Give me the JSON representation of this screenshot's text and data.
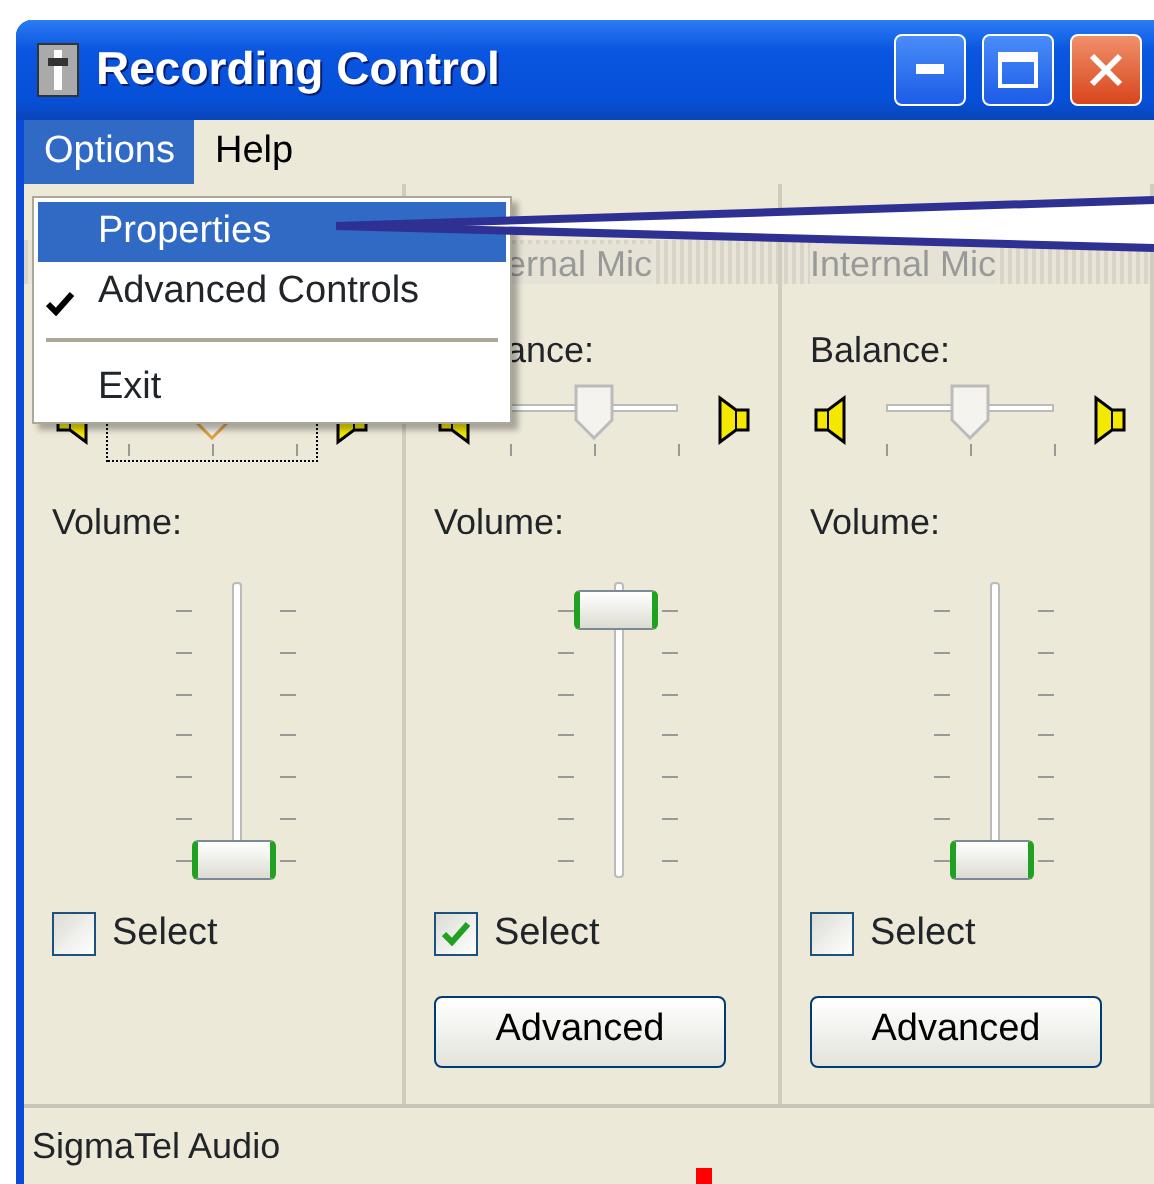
{
  "window": {
    "title": "Recording Control"
  },
  "menu_bar": [
    {
      "label": "Options",
      "selected": true
    },
    {
      "label": "Help",
      "selected": false
    }
  ],
  "dropdown": [
    {
      "kind": "item",
      "label": "Properties",
      "selected": true,
      "checked": false
    },
    {
      "kind": "item",
      "label": "Advanced Controls",
      "selected": false,
      "checked": true
    },
    {
      "kind": "separator"
    },
    {
      "kind": "item",
      "label": "Exit",
      "selected": false,
      "checked": false
    }
  ],
  "channels": [
    {
      "balance": {
        "level": 0.5,
        "focused": true
      },
      "volume_label": "Volume:",
      "volume": {
        "level": 0
      },
      "select": {
        "label": "Select",
        "checked": false
      }
    },
    {
      "heading": "ernal Mic",
      "balance_label": "ance:",
      "balance": {
        "level": 0.5,
        "focused": false
      },
      "volume_label": "Volume:",
      "volume": {
        "level": 1
      },
      "select": {
        "label": "Select",
        "checked": true
      },
      "advanced": "Advanced"
    },
    {
      "heading": "Internal Mic",
      "balance_label": "Balance:",
      "balance": {
        "level": 0.5,
        "focused": false
      },
      "volume_label": "Volume:",
      "volume": {
        "level": 0
      },
      "select": {
        "label": "Select",
        "checked": false
      },
      "advanced": "Advanced"
    }
  ],
  "status_bar": "SigmaTel Audio"
}
